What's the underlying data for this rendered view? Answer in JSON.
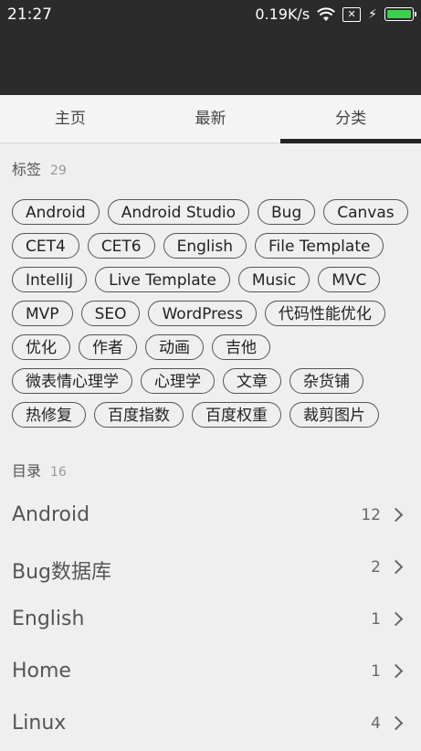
{
  "status_bar": {
    "time": "21:27",
    "network_speed": "0.19K/s",
    "icons": [
      "wifi-icon",
      "sim-x-icon",
      "charging-bolt-icon",
      "battery-icon"
    ],
    "battery_color": "#3ccf4e"
  },
  "tabs": [
    {
      "label": "主页"
    },
    {
      "label": "最新"
    },
    {
      "label": "分类"
    }
  ],
  "active_tab": "分类",
  "tags_section": {
    "title": "标签",
    "count": "29",
    "rows": [
      [
        "Android",
        "Android Studio",
        "Bug",
        "Canvas"
      ],
      [
        "CET4",
        "CET6",
        "English",
        "File Template"
      ],
      [
        "IntelliJ",
        "Live Template",
        "Music",
        "MVC"
      ],
      [
        "MVP",
        "SEO",
        "WordPress",
        "代码性能优化"
      ],
      [
        "优化",
        "作者",
        "动画",
        "吉他"
      ],
      [
        "微表情心理学",
        "心理学",
        "文章",
        "杂货铺"
      ],
      [
        "热修复",
        "百度指数",
        "百度权重",
        "裁剪图片"
      ]
    ]
  },
  "directory_section": {
    "title": "目录",
    "count": "16",
    "items": [
      {
        "name": "Android",
        "count": "12"
      },
      {
        "name": "Bug数据库",
        "count": "2"
      },
      {
        "name": "English",
        "count": "1"
      },
      {
        "name": "Home",
        "count": "1"
      },
      {
        "name": "Linux",
        "count": "4"
      }
    ]
  }
}
